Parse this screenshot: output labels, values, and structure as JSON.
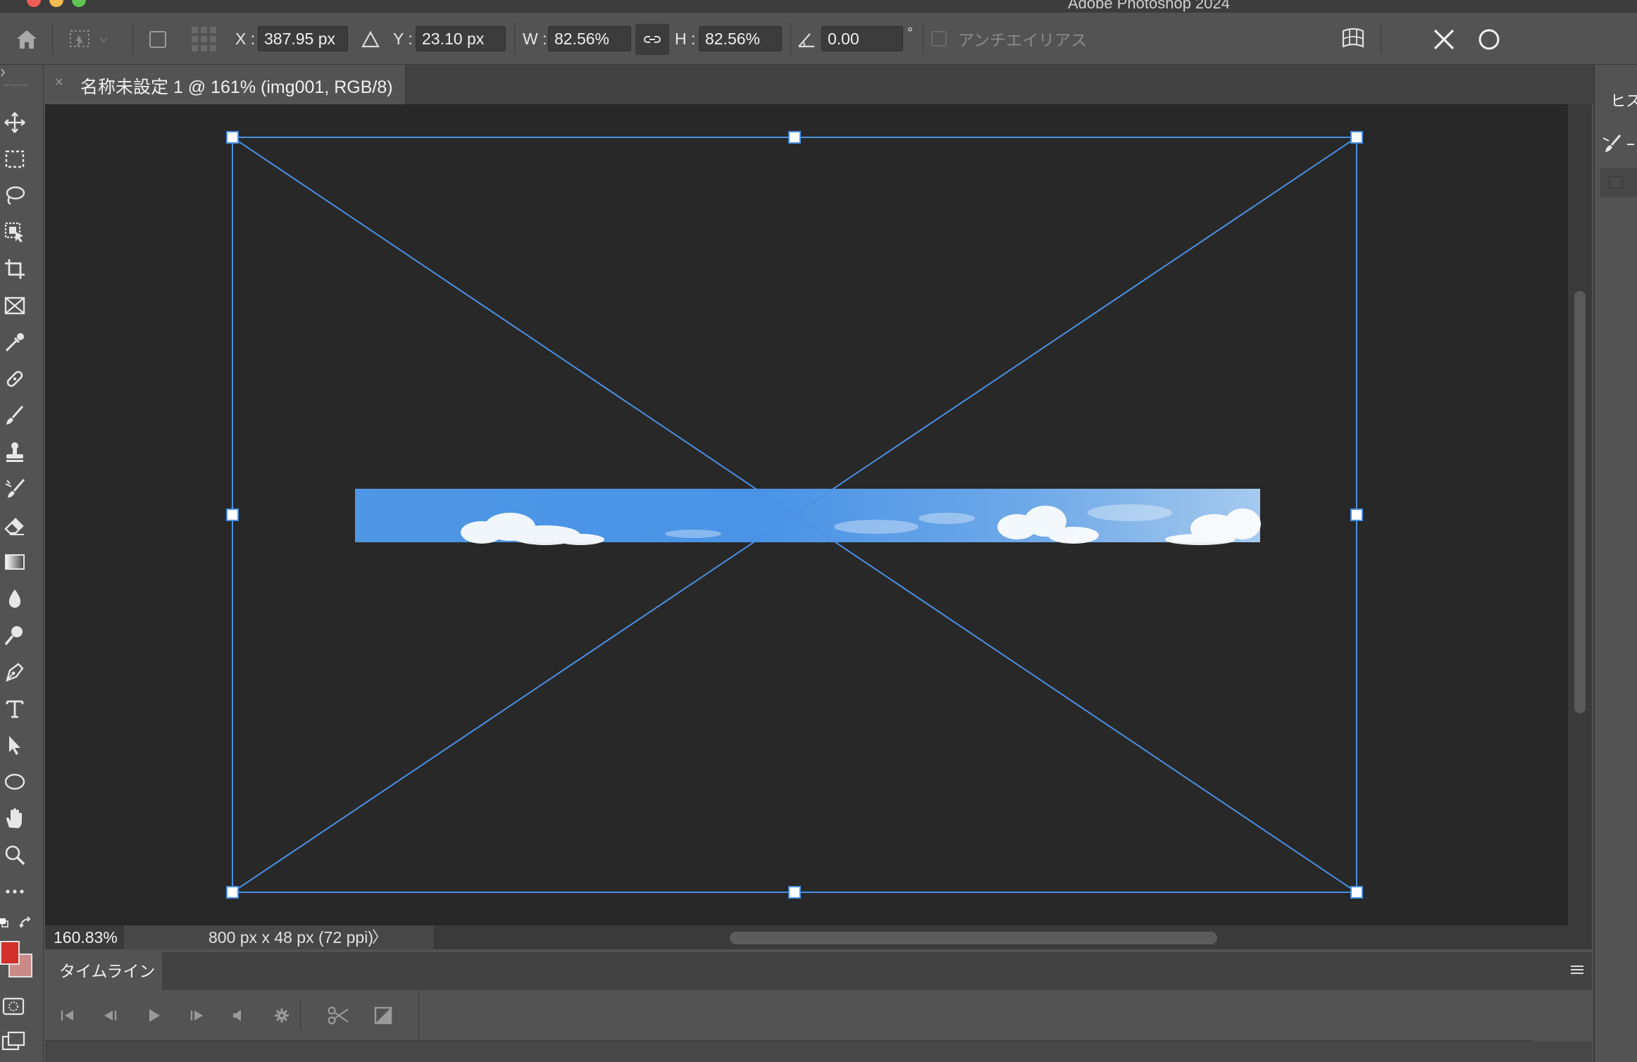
{
  "window": {
    "app_title": "Adobe Photoshop 2024"
  },
  "options_bar": {
    "x_label": "X :",
    "x_value": "387.95 px",
    "y_label": "Y :",
    "y_value": "23.10 px",
    "w_label": "W :",
    "w_value": "82.56%",
    "h_label": "H :",
    "h_value": "82.56%",
    "angle_value": "0.00",
    "degree_symbol": "°",
    "antialias_label": "アンチエイリアス",
    "antialias_checked": false
  },
  "document": {
    "tab_close": "×",
    "tab_title": "名称未設定 1 @ 161% (img001, RGB/8)"
  },
  "status_bar": {
    "zoom": "160.83%",
    "doc_info": "800 px x 48 px (72 ppi)",
    "arrow": "〉"
  },
  "right_panel": {
    "tab_label": "ヒス"
  },
  "timeline": {
    "tab_label": "タイムライン"
  },
  "colors": {
    "foreground": "#d2302a",
    "background": "#c98a88",
    "selection": "#4a90e2",
    "canvas": "#282828"
  },
  "tools": [
    "move-icon",
    "marquee-icon",
    "lasso-icon",
    "object-select-icon",
    "crop-icon",
    "frame-icon",
    "eyedropper-icon",
    "healing-icon",
    "brush-icon",
    "stamp-icon",
    "history-brush-icon",
    "eraser-icon",
    "gradient-icon",
    "blur-icon",
    "dodge-icon",
    "pen-icon",
    "type-icon",
    "path-select-icon",
    "ellipse-icon",
    "hand-icon",
    "zoom-icon",
    "more-icon"
  ]
}
